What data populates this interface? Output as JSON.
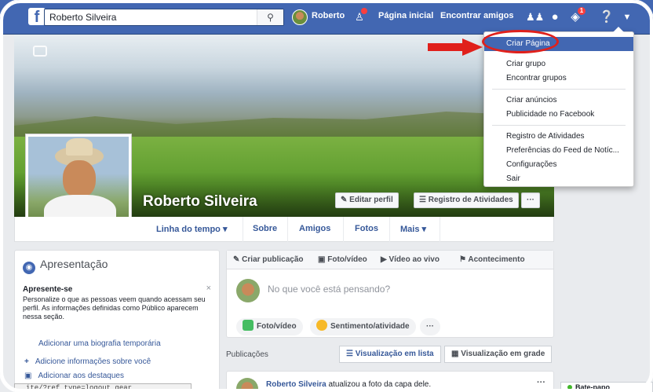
{
  "topbar": {
    "search_value": "Roberto Silveira",
    "search_icon": "search-icon",
    "profile_name": "Roberto",
    "home_label": "Página inicial",
    "find_friends_label": "Encontrar amigos",
    "friend_requests_icon": "friends-icon",
    "messages_icon": "messenger-icon",
    "notifications_icon": "globe-notification-icon",
    "notifications_count": "1",
    "help_icon": "question-icon",
    "menu_icon": "caret-down-icon",
    "accent_color": "#4267b2"
  },
  "cover": {
    "name": "Roberto Silveira",
    "edit_profile_label": "Editar perfil",
    "activity_log_label": "Registro de Atividades",
    "more_label": "···"
  },
  "timeline_nav": [
    {
      "label": "Linha do tempo ▾"
    },
    {
      "label": "Sobre"
    },
    {
      "label": "Amigos"
    },
    {
      "label": "Fotos"
    },
    {
      "label": "Mais ▾"
    }
  ],
  "intro": {
    "title": "Apresentação",
    "subtitle": "Apresente-se",
    "close": "×",
    "description": "Personalize o que as pessoas veem quando acessam seu perfil. As informações definidas como Público aparecem nessa seção.",
    "link_bio": "Adicionar uma biografia temporária",
    "link_info": "Adicione informações sobre você",
    "link_highlights": "Adicionar aos destaques",
    "status_url": "ite/?ref_type=logout_gear"
  },
  "composer": {
    "tab_create": "Criar publicação",
    "tab_photo": "Foto/vídeo",
    "tab_live": "Vídeo ao vivo",
    "tab_event": "Acontecimento",
    "placeholder": "No que você está pensando?",
    "btn_photo": "Foto/vídeo",
    "btn_feeling": "Sentimento/atividade",
    "btn_more": "···"
  },
  "publications": {
    "title": "Publicações",
    "list_view": "Visualização em lista",
    "grid_view": "Visualização em grade",
    "post_author": "Roberto Silveira",
    "post_text": "atualizou a foto da capa dele.",
    "post_more": "···"
  },
  "chat": {
    "label": "Bate-papo",
    "status_color": "#42b72a"
  },
  "dropdown": {
    "items_group1": [
      "Criar Página",
      "Criar grupo",
      "Encontrar grupos"
    ],
    "items_group2": [
      "Criar anúncios",
      "Publicidade no Facebook"
    ],
    "items_group3": [
      "Registro de Atividades",
      "Preferências do Feed de Notíc...",
      "Configurações",
      "Sair"
    ],
    "highlight_color": "#e0201b"
  }
}
